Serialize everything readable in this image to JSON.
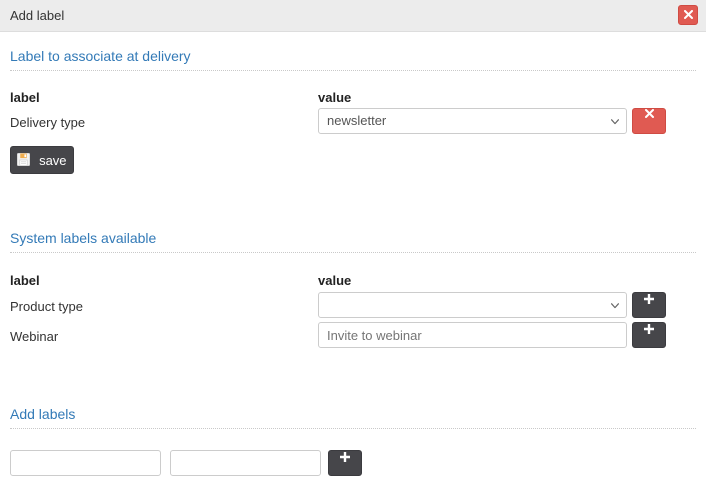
{
  "header": {
    "title": "Add label",
    "close_icon": "close-icon",
    "close_glyph": "✖"
  },
  "colors": {
    "header_bg": "#ececec",
    "link_blue": "#337ab7",
    "danger_red": "#e05a52",
    "dark_button": "#46464a",
    "border_gray": "#cccccc",
    "text": "#333333"
  },
  "delivery_section": {
    "heading": "Label to associate at delivery",
    "columns": {
      "label": "label",
      "value": "value"
    },
    "rows": [
      {
        "label": "Delivery type",
        "control": "select",
        "value": "newsletter",
        "placeholder": "",
        "action_icon": "close-icon",
        "action_glyph": "✖",
        "action_style": "danger"
      }
    ],
    "save_button": {
      "label": "save",
      "icon": "save-floppy-icon"
    }
  },
  "system_section": {
    "heading": "System labels available",
    "columns": {
      "label": "label",
      "value": "value"
    },
    "rows": [
      {
        "label": "Product type",
        "control": "select",
        "value": "",
        "placeholder": "",
        "action_icon": "plus-icon",
        "action_glyph": "＋",
        "action_style": "dark"
      },
      {
        "label": "Webinar",
        "control": "text",
        "value": "",
        "placeholder": "Invite to webinar",
        "action_icon": "plus-icon",
        "action_glyph": "＋",
        "action_style": "dark"
      }
    ]
  },
  "add_section": {
    "heading": "Add labels",
    "label_input": {
      "value": "",
      "placeholder": ""
    },
    "value_input": {
      "value": "",
      "placeholder": ""
    },
    "add_button": {
      "icon": "plus-icon",
      "glyph": "＋"
    }
  }
}
